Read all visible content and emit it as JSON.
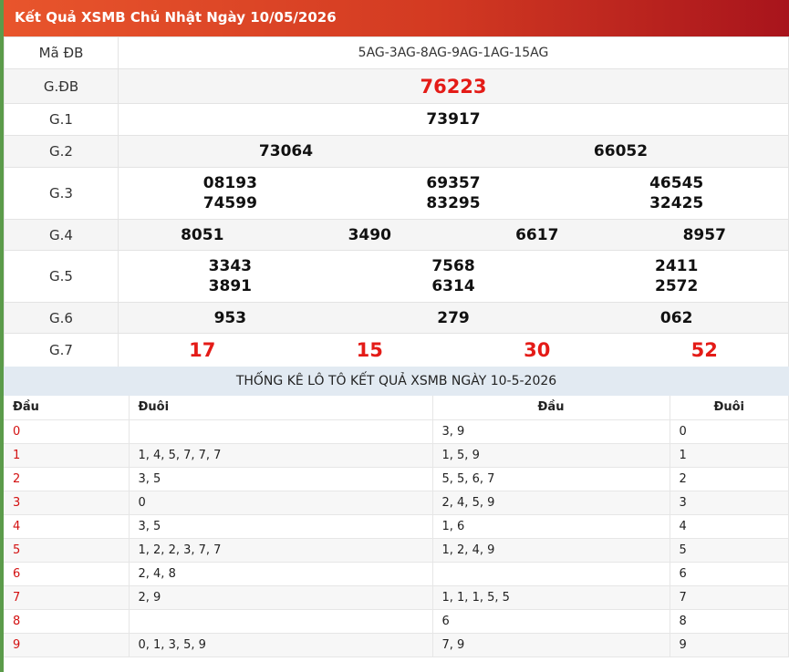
{
  "header": {
    "title": "Kết Quả XSMB Chủ Nhật Ngày 10/05/2026"
  },
  "colors": {
    "accent": "#e41b17",
    "header_start": "#e8552c",
    "header_end": "#a8141c",
    "stat_bg": "#e2eaf2"
  },
  "results": {
    "ma_db": {
      "label": "Mã ĐB",
      "value": "5AG-3AG-8AG-9AG-1AG-15AG"
    },
    "gdb": {
      "label": "G.ĐB",
      "numbers": [
        "76223"
      ]
    },
    "g1": {
      "label": "G.1",
      "numbers": [
        "73917"
      ]
    },
    "g2": {
      "label": "G.2",
      "numbers": [
        "73064",
        "66052"
      ]
    },
    "g3": {
      "label": "G.3",
      "numbers": [
        "08193",
        "74599",
        "69357",
        "83295",
        "46545",
        "32425"
      ]
    },
    "g4": {
      "label": "G.4",
      "numbers": [
        "8051",
        "3490",
        "6617",
        "8957"
      ]
    },
    "g5": {
      "label": "G.5",
      "numbers": [
        "3343",
        "3891",
        "7568",
        "6314",
        "2411",
        "2572"
      ]
    },
    "g6": {
      "label": "G.6",
      "numbers": [
        "953",
        "279",
        "062"
      ]
    },
    "g7": {
      "label": "G.7",
      "numbers": [
        "17",
        "15",
        "30",
        "52"
      ]
    }
  },
  "stats": {
    "title": "THỐNG KÊ LÔ TÔ KẾT QUẢ XSMB NGÀY 10-5-2026",
    "headers": [
      "Đầu",
      "Đuôi",
      "Đầu",
      "Đuôi"
    ],
    "rows": [
      {
        "dau": "0",
        "duoi": "",
        "dau2": "3, 9",
        "duoi2": "0"
      },
      {
        "dau": "1",
        "duoi": "1, 4, 5, 7, 7, 7",
        "dau2": "1, 5, 9",
        "duoi2": "1"
      },
      {
        "dau": "2",
        "duoi": "3, 5",
        "dau2": "5, 5, 6, 7",
        "duoi2": "2"
      },
      {
        "dau": "3",
        "duoi": "0",
        "dau2": "2, 4, 5, 9",
        "duoi2": "3"
      },
      {
        "dau": "4",
        "duoi": "3, 5",
        "dau2": "1, 6",
        "duoi2": "4"
      },
      {
        "dau": "5",
        "duoi": "1, 2, 2, 3, 7, 7",
        "dau2": "1, 2, 4, 9",
        "duoi2": "5"
      },
      {
        "dau": "6",
        "duoi": "2, 4, 8",
        "dau2": "",
        "duoi2": "6"
      },
      {
        "dau": "7",
        "duoi": "2, 9",
        "dau2": "1, 1, 1, 5, 5",
        "duoi2": "7"
      },
      {
        "dau": "8",
        "duoi": "",
        "dau2": "6",
        "duoi2": "8"
      },
      {
        "dau": "9",
        "duoi": "0, 1, 3, 5, 9",
        "dau2": "7, 9",
        "duoi2": "9"
      }
    ]
  }
}
